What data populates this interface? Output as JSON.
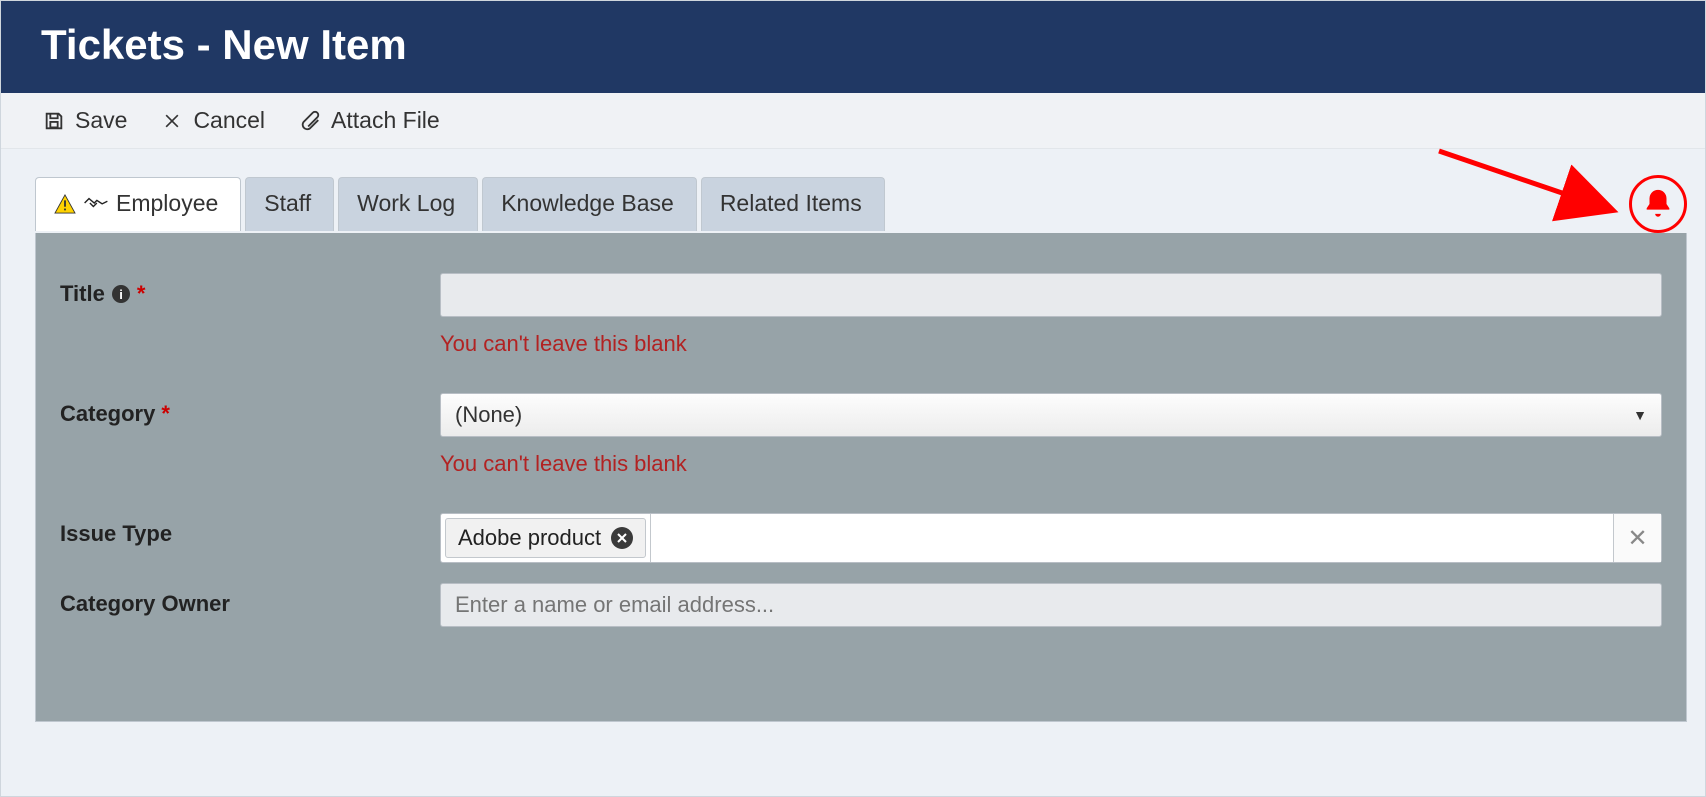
{
  "header": {
    "title": "Tickets - New Item"
  },
  "toolbar": {
    "save_label": "Save",
    "cancel_label": "Cancel",
    "attach_label": "Attach File"
  },
  "tabs": {
    "employee": "Employee",
    "staff": "Staff",
    "worklog": "Work Log",
    "kb": "Knowledge Base",
    "related": "Related Items"
  },
  "form": {
    "title_label": "Title",
    "title_value": "",
    "title_error": "You can't leave this blank",
    "category_label": "Category",
    "category_value": "(None)",
    "category_error": "You can't leave this blank",
    "issue_type_label": "Issue Type",
    "issue_type_tag": "Adobe product",
    "category_owner_label": "Category Owner",
    "category_owner_placeholder": "Enter a name or email address..."
  },
  "annotation": {
    "bell_highlight": true,
    "arrow": true
  }
}
